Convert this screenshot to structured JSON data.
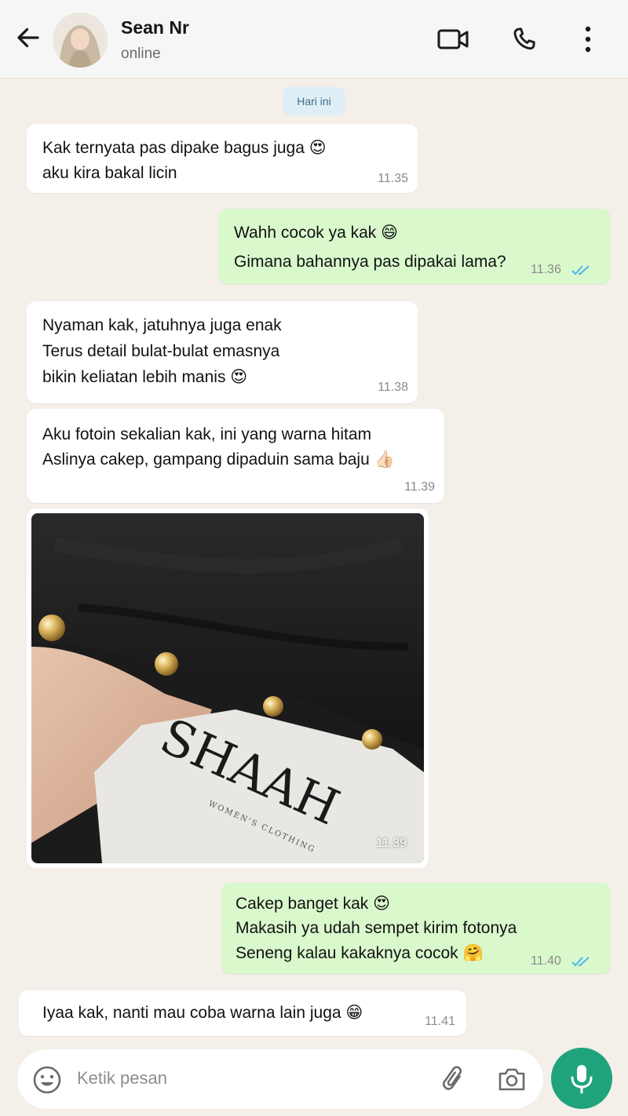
{
  "header": {
    "name": "Sean Nr",
    "status": "online"
  },
  "date_chip": "Hari ini",
  "messages": [
    {
      "dir": "in",
      "lines": [
        "Kak ternyata pas dipake bagus juga 😍",
        "aku kira bakal licin"
      ],
      "time": "11.35"
    },
    {
      "dir": "out",
      "lines": [
        "Wahh cocok ya kak 😄",
        "Gimana bahannya pas dipakai lama?"
      ],
      "time": "11.36",
      "status": "read"
    },
    {
      "dir": "in",
      "lines": [
        "Nyaman kak, jatuhnya juga enak",
        "Terus detail bulat-bulat emasnya",
        "bikin keliatan lebih manis 😍"
      ],
      "time": "11.38"
    },
    {
      "dir": "in",
      "lines": [
        "Aku fotoin sekalian kak, ini yang warna hitam",
        "Aslinya cakep, gampang dipaduin sama baju 👍🏻"
      ],
      "time": "11.39"
    },
    {
      "dir": "out",
      "lines": [
        "Cakep banget kak 😍",
        "Makasih ya udah sempet kirim fotonya",
        "Seneng kalau kakaknya cocok 🤗"
      ],
      "time": "11.40",
      "status": "read"
    },
    {
      "dir": "in",
      "lines": [
        "Iyaa kak, nanti mau coba warna lain juga 😁"
      ],
      "time": "11.41"
    }
  ],
  "photo": {
    "brand_text": "SHAAH",
    "brand_sub": "WOMEN'S CLOTHING",
    "time": "11.39"
  },
  "composer": {
    "placeholder": "Ketik pesan"
  },
  "colors": {
    "chat_bg": "#f4efe9",
    "incoming": "#ffffff",
    "outgoing": "#d9f8cc",
    "read_ticks": "#4fb6ec",
    "mic_button": "#1fa37c"
  },
  "icons": [
    "back-arrow-icon",
    "video-call-icon",
    "phone-icon",
    "more-vert-icon",
    "emoji-icon",
    "attach-icon",
    "camera-icon",
    "mic-icon",
    "read-ticks-icon"
  ]
}
